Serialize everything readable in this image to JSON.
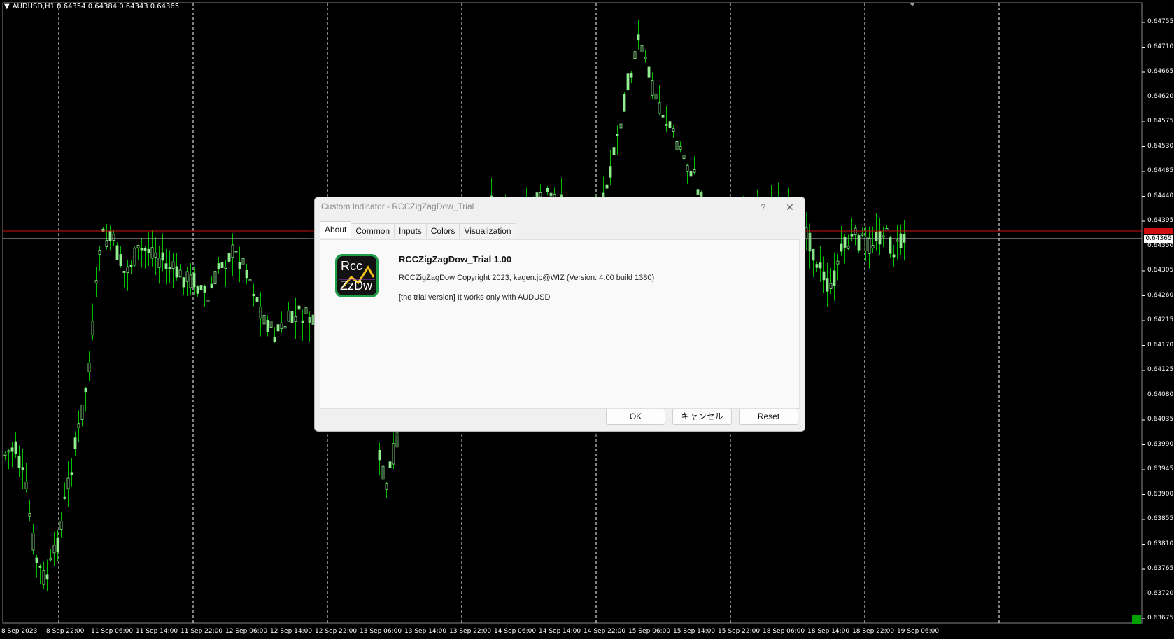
{
  "chart": {
    "title": "AUDUSD,H1  0.64354 0.64384 0.64343 0.64365",
    "current_price": "0.64365",
    "price_axis": [
      "0.64755",
      "0.64710",
      "0.64665",
      "0.64620",
      "0.64575",
      "0.64530",
      "0.64485",
      "0.64440",
      "0.64395",
      "0.64350",
      "0.64305",
      "0.64260",
      "0.64215",
      "0.64170",
      "0.64125",
      "0.64080",
      "0.64035",
      "0.63990",
      "0.63945",
      "0.63900",
      "0.63855",
      "0.63810",
      "0.63765",
      "0.63720",
      "0.63675"
    ],
    "time_axis": [
      "8 Sep 2023",
      "8 Sep 22:00",
      "11 Sep 06:00",
      "11 Sep 14:00",
      "11 Sep 22:00",
      "12 Sep 06:00",
      "12 Sep 14:00",
      "12 Sep 22:00",
      "13 Sep 06:00",
      "13 Sep 14:00",
      "13 Sep 22:00",
      "14 Sep 06:00",
      "14 Sep 14:00",
      "14 Sep 22:00",
      "15 Sep 06:00",
      "15 Sep 14:00",
      "15 Sep 22:00",
      "18 Sep 06:00",
      "18 Sep 14:00",
      "18 Sep 22:00",
      "19 Sep 06:00"
    ],
    "colors": {
      "background": "#000000",
      "candle": "#90EE90",
      "wick": "#00C000",
      "grid": "#FFFFFF",
      "ask_line": "#D01010",
      "bid_line": "#C0C0C0"
    },
    "corner_button": "–"
  },
  "dialog": {
    "title": "Custom Indicator - RCCZigZagDow_Trial",
    "help_icon": "?",
    "close_icon": "✕",
    "tabs": [
      {
        "label": "About",
        "active": true
      },
      {
        "label": "Common",
        "active": false
      },
      {
        "label": "Inputs",
        "active": false
      },
      {
        "label": "Colors",
        "active": false
      },
      {
        "label": "Visualization",
        "active": false
      }
    ],
    "icon_text_top": "Rcc",
    "icon_text_bottom": "ZzDw",
    "indicator_name": "RCCZigZagDow_Trial 1.00",
    "copyright": "RCCZigZagDow Copyright 2023, kagen.jp@WIZ (Version: 4.00 build 1380)",
    "note": "[the trial version] It works only with AUDUSD",
    "buttons": {
      "ok": "OK",
      "cancel": "キャンセル",
      "reset": "Reset"
    }
  }
}
